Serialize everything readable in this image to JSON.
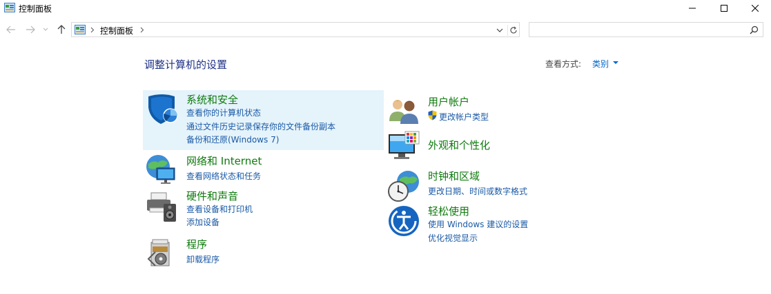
{
  "window": {
    "title": "控制面板",
    "controls": [
      "minimize",
      "maximize",
      "close"
    ]
  },
  "nav": {
    "breadcrumb": "控制面板",
    "search_placeholder": ""
  },
  "main": {
    "heading": "调整计算机的设置",
    "view_by_label": "查看方式:",
    "view_by_value": "类别"
  },
  "categories": {
    "system_security": {
      "title": "系统和安全",
      "links": [
        "查看你的计算机状态",
        "通过文件历史记录保存你的文件备份副本",
        "备份和还原(Windows 7)"
      ]
    },
    "network": {
      "title": "网络和 Internet",
      "links": [
        "查看网络状态和任务"
      ]
    },
    "hardware": {
      "title": "硬件和声音",
      "links": [
        "查看设备和打印机",
        "添加设备"
      ]
    },
    "programs": {
      "title": "程序",
      "links": [
        "卸载程序"
      ]
    },
    "user_accounts": {
      "title": "用户帐户",
      "links": [
        "更改帐户类型"
      ]
    },
    "appearance": {
      "title": "外观和个性化",
      "links": []
    },
    "clock_region": {
      "title": "时钟和区域",
      "links": [
        "更改日期、时间或数字格式"
      ]
    },
    "ease_access": {
      "title": "轻松使用",
      "links": [
        "使用 Windows 建议的设置",
        "优化视觉显示"
      ]
    }
  },
  "colors": {
    "category_title": "#0e7a0d",
    "link": "#1a5aa6",
    "heading": "#1e3287",
    "highlight": "#e5f3fb"
  }
}
